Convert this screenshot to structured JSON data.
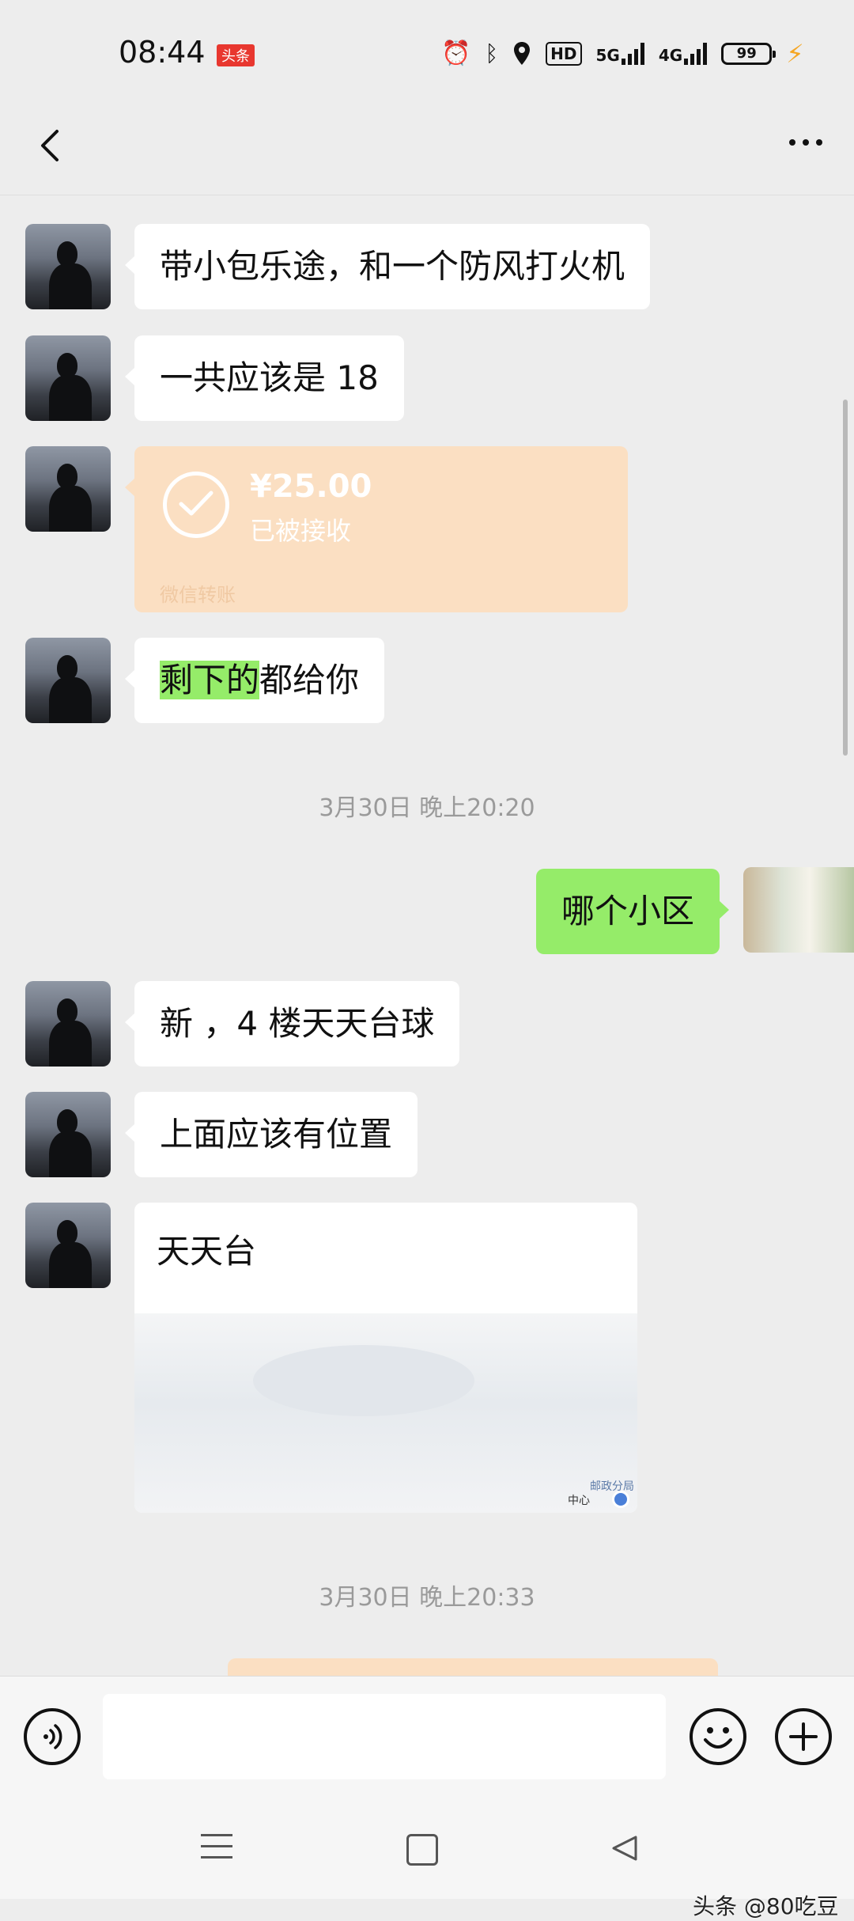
{
  "status_bar": {
    "time": "08:44",
    "app_badge": "头条",
    "hd_label": "HD",
    "net1": "5G",
    "net2": "4G",
    "battery": "99"
  },
  "header": {
    "back_icon": "chevron-left-icon",
    "more_icon": "more-dots-icon"
  },
  "messages": [
    {
      "from": "other",
      "type": "text",
      "text": "带小包乐途，和一个防风打火机"
    },
    {
      "from": "other",
      "type": "text",
      "text": "一共应该是 18"
    },
    {
      "from": "other",
      "type": "transfer",
      "amount": "¥25.00",
      "status": "已被接收",
      "brand": "微信转账"
    },
    {
      "from": "other",
      "type": "text",
      "highlight": "剩下的",
      "text": "都给你"
    },
    {
      "type": "time",
      "text": "3月30日 晚上20:20"
    },
    {
      "from": "me",
      "type": "text",
      "text": "哪个小区"
    },
    {
      "from": "other",
      "type": "text",
      "text": "新      ，4 楼天天台球"
    },
    {
      "from": "other",
      "type": "text",
      "text": "上面应该有位置"
    },
    {
      "from": "other",
      "type": "location",
      "name": "天天台"
    },
    {
      "type": "time",
      "text": "3月30日 晚上20:33"
    }
  ],
  "map_labels": [
    "邮政分局",
    "中心"
  ],
  "input": {
    "placeholder": "",
    "value": ""
  },
  "icons": [
    "voice-icon",
    "emoji-icon",
    "plus-icon",
    "menu-icon",
    "home-icon",
    "back-triangle-icon"
  ],
  "watermark": "头条 @80吃豆",
  "colors": {
    "background": "#ededed",
    "my_bubble": "#95ec69",
    "transfer_card": "#fbdfc2"
  }
}
